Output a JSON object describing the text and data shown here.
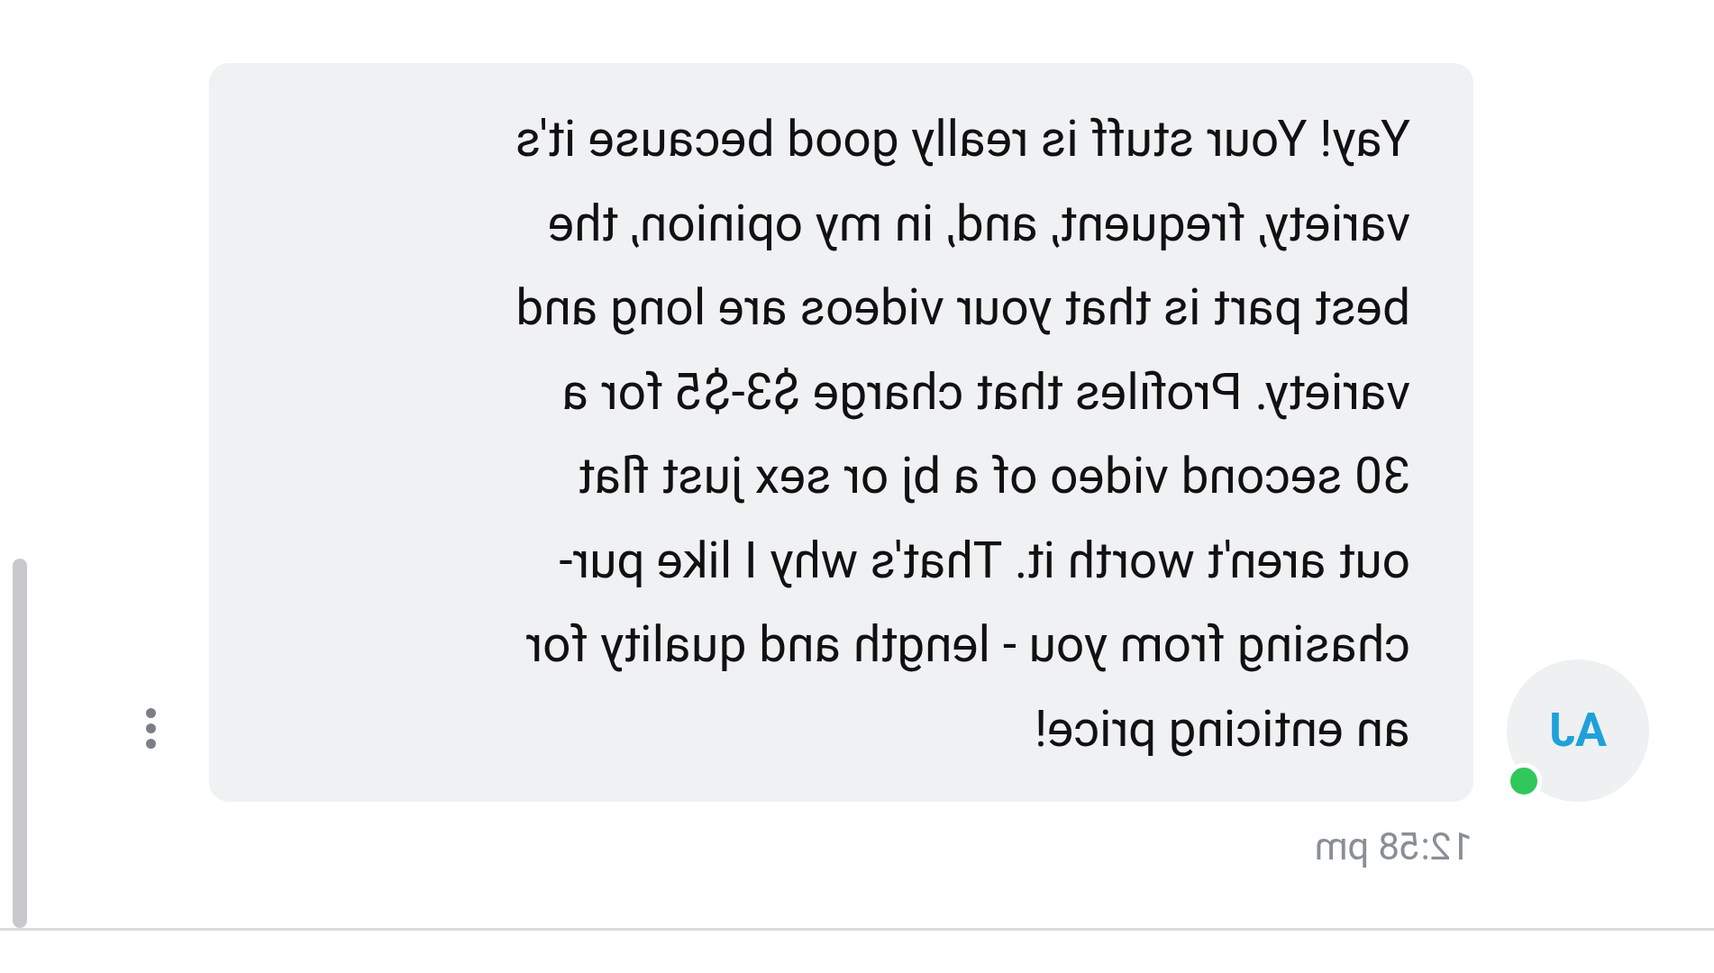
{
  "message": {
    "lines": [
      "Yay! Your stuff is really good because it's",
      "variety, frequent, and, in my opinion, the",
      "best part is that your videos are long and",
      "variety. Profiles that charge $3-$5 for a",
      "30 second video of a bj or sex just flat",
      "out aren't worth it. That's why I like pur-",
      "chasing from you - length and quality for",
      "an enticing price!"
    ],
    "time": "12:58 pm"
  },
  "avatar": {
    "initials": "AJ",
    "online": true
  }
}
